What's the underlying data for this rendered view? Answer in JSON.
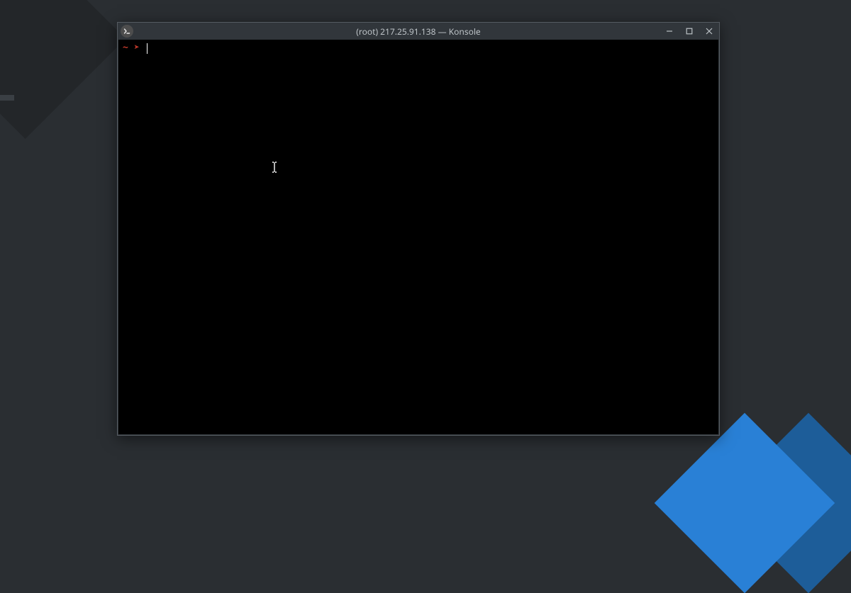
{
  "window": {
    "title": "(root) 217.25.91.138 — Konsole"
  },
  "terminal": {
    "prompt": {
      "path": "~",
      "arrow": "➤",
      "input": ""
    }
  }
}
